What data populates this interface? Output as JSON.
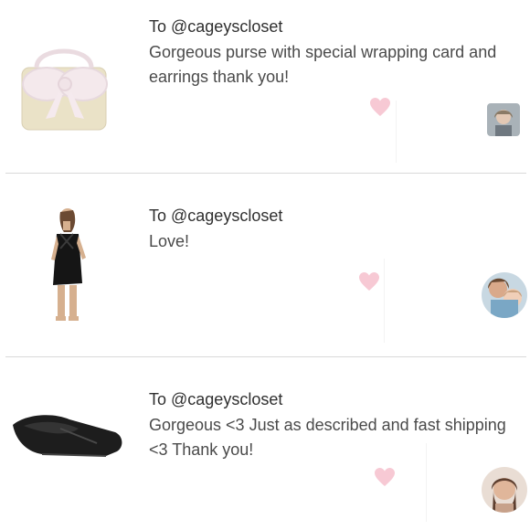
{
  "reviews": [
    {
      "to_line": "To @cageyscloset",
      "comment": "Gorgeous purse with special wrapping card and earrings thank you!",
      "product": "purse-with-bow",
      "avatar": "reviewer-avatar-1"
    },
    {
      "to_line": "To @cageyscloset",
      "comment": "Love!",
      "product": "black-dress",
      "avatar": "reviewer-avatar-2"
    },
    {
      "to_line": "To @cageyscloset",
      "comment": "Gorgeous <3 Just as described and fast shipping <3 Thank you!",
      "product": "black-flat-shoe",
      "avatar": "reviewer-avatar-3"
    }
  ],
  "colors": {
    "heart": "#f7c9d4",
    "divider": "#d9d9d9",
    "text": "#4a4a4a"
  }
}
